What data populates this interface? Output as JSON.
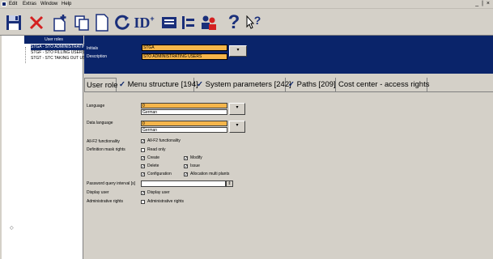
{
  "menubar": {
    "items": [
      "Edit",
      "Extras",
      "Window",
      "Help"
    ],
    "window_controls": "_ | ×"
  },
  "toolbar": {
    "id_label": "ID",
    "help_label": "?",
    "context_help_label": "?"
  },
  "tree": {
    "header": "User roles",
    "items": [
      {
        "label": "STGA - STO ADMINISTRATING USERS",
        "selected": true
      },
      {
        "label": "STGF - STO FILLING USERS",
        "selected": false
      },
      {
        "label": "STGT - STC TAKING OUT USERS",
        "selected": false
      }
    ],
    "collapse_arrow": "◇"
  },
  "header": {
    "initials_label": "Initials",
    "initials_value": "STGA",
    "description_label": "Description",
    "description_value": "STO ADMINISTRATING USERS",
    "dropdown_symbol": "▾"
  },
  "tabs": [
    {
      "label": "User role",
      "checked": false,
      "active": true
    },
    {
      "label": "Menu structure [194]",
      "checked": true,
      "active": false
    },
    {
      "label": "System parameters [242]",
      "checked": true,
      "active": false
    },
    {
      "label": "Paths [209]",
      "checked": true,
      "active": false
    },
    {
      "label": "Cost center - access rights",
      "checked": false,
      "active": false
    }
  ],
  "form": {
    "language_label": "Language",
    "language_code": "0",
    "language_name": "German",
    "data_language_label": "Data language",
    "data_language_code": "0",
    "data_language_name": "German",
    "dropdown_symbol": "▾",
    "allf2_label": "All-F2 functionality",
    "allf2_checkbox_label": "All-F2 functionality",
    "allf2_checked": true,
    "definition_label": "Definition mask rights",
    "rights": {
      "read_only": {
        "label": "Read only",
        "checked": false
      },
      "create": {
        "label": "Create",
        "checked": true
      },
      "modify": {
        "label": "Modify",
        "checked": true
      },
      "delete": {
        "label": "Delete",
        "checked": true
      },
      "issue": {
        "label": "Issue",
        "checked": true
      },
      "configuration": {
        "label": "Configuration",
        "checked": true
      },
      "allocation": {
        "label": "Allocation multi plants",
        "checked": true
      }
    },
    "password_label": "Password query interval [s]",
    "password_value": "",
    "display_user_label": "Display user",
    "display_user_checkbox_label": "Display user",
    "display_user_checked": true,
    "admin_label": "Administrative rights",
    "admin_checkbox_label": "Administrative rights",
    "admin_checked": false
  }
}
